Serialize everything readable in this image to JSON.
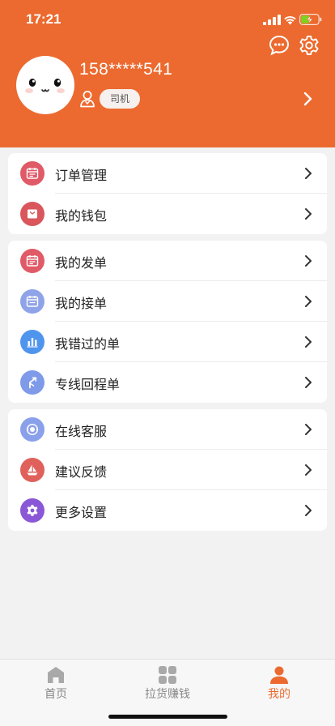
{
  "status_bar": {
    "time": "17:21"
  },
  "profile": {
    "phone": "158*****541",
    "role": "司机"
  },
  "groups": [
    {
      "items": [
        {
          "label": "订单管理",
          "icon": "order-management-icon",
          "color": "#e05a68"
        },
        {
          "label": "我的钱包",
          "icon": "wallet-icon",
          "color": "#d9565c"
        }
      ]
    },
    {
      "items": [
        {
          "label": "我的发单",
          "icon": "sent-orders-icon",
          "color": "#e05a68"
        },
        {
          "label": "我的接单",
          "icon": "accepted-orders-icon",
          "color": "#8fa3e8"
        },
        {
          "label": "我错过的单",
          "icon": "missed-orders-icon",
          "color": "#4f95ee"
        },
        {
          "label": "专线回程单",
          "icon": "return-route-icon",
          "color": "#7f9ae8"
        }
      ]
    },
    {
      "items": [
        {
          "label": "在线客服",
          "icon": "customer-service-icon",
          "color": "#8aa0ea"
        },
        {
          "label": "建议反馈",
          "icon": "feedback-icon",
          "color": "#e0615b"
        },
        {
          "label": "更多设置",
          "icon": "settings-icon",
          "color": "#8a58d6"
        }
      ]
    }
  ],
  "tabbar": {
    "tabs": [
      {
        "label": "首页",
        "icon": "home-icon"
      },
      {
        "label": "拉货赚钱",
        "icon": "grid-icon"
      },
      {
        "label": "我的",
        "icon": "person-icon",
        "active": true
      }
    ]
  },
  "colors": {
    "brand": "#ec6a2f",
    "background": "#f2f2f2",
    "text": "#222222",
    "tab_inactive": "#888888"
  }
}
